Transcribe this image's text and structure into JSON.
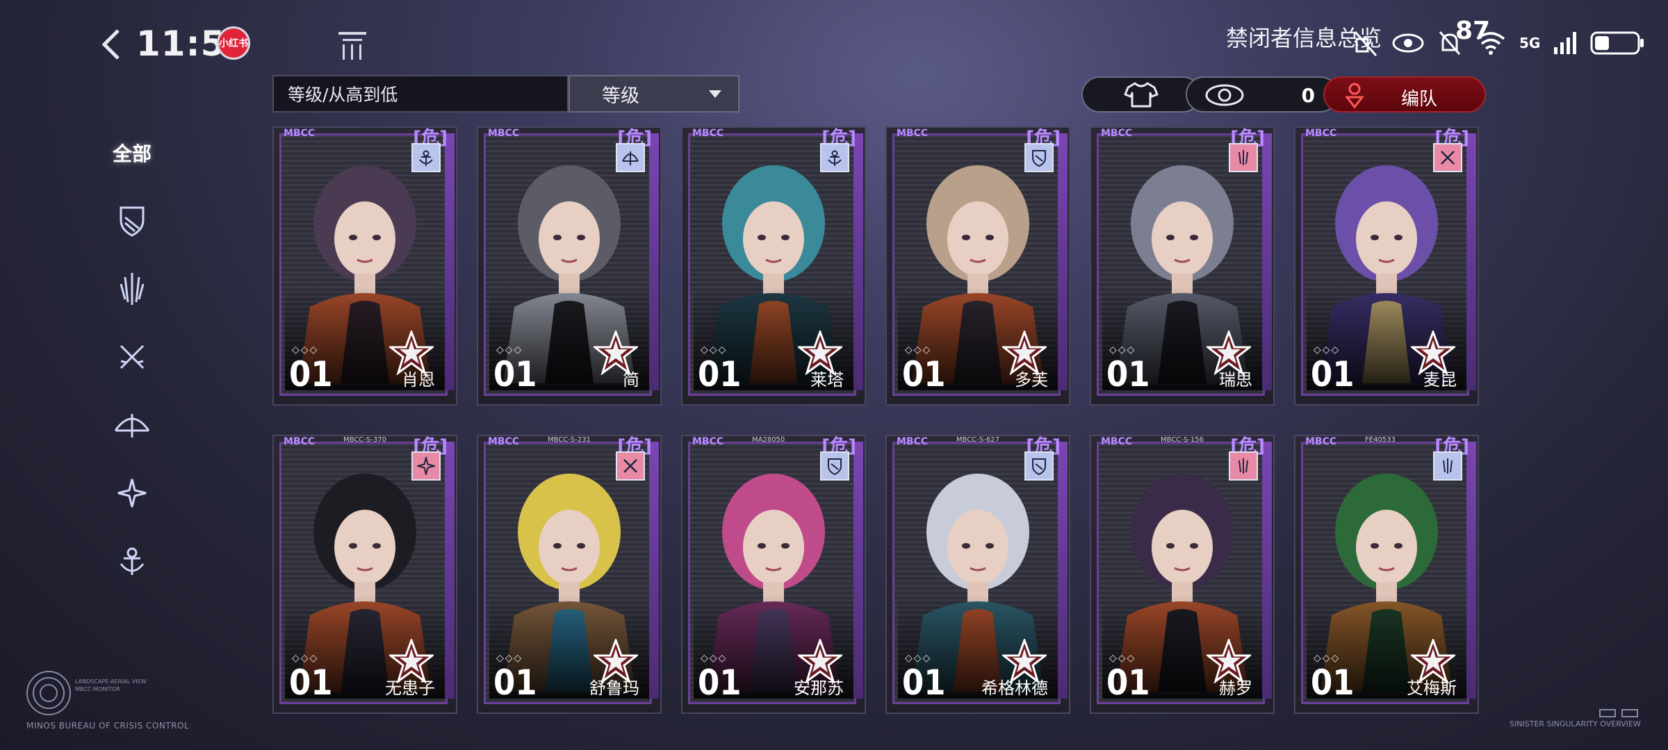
{
  "status_bar": {
    "time": "11:58",
    "notification_app": "小红书",
    "battery": "87",
    "network": "5G"
  },
  "header": {
    "title": "禁闭者信息总览",
    "watermark": "MBCC"
  },
  "toolbar": {
    "sort_label": "等级/从高到低",
    "sort_selected": "等级",
    "visibility_count": "0",
    "team_label": "编队"
  },
  "sidebar": {
    "all_label": "全部",
    "class_icons": [
      "shield-class-icon",
      "blade-class-icon",
      "crossed-swords-class-icon",
      "bow-class-icon",
      "star-class-icon",
      "support-class-icon"
    ]
  },
  "cards": [
    {
      "name": "肖恩",
      "level": "01",
      "serial": "",
      "danger": "[危]",
      "class_icon": "support-class-icon",
      "class_color": "#b9c4ec"
    },
    {
      "name": "简",
      "level": "01",
      "serial": "",
      "danger": "[危]",
      "class_icon": "bow-class-icon",
      "class_color": "#b9c4ec"
    },
    {
      "name": "莱塔",
      "level": "01",
      "serial": "",
      "danger": "[危]",
      "class_icon": "support-class-icon",
      "class_color": "#b9c4ec"
    },
    {
      "name": "多芙",
      "level": "01",
      "serial": "",
      "danger": "[危]",
      "class_icon": "shield-class-icon",
      "class_color": "#b9c4ec"
    },
    {
      "name": "瑞思",
      "level": "01",
      "serial": "",
      "danger": "[危]",
      "class_icon": "blade-class-icon",
      "class_color": "#e88aa6"
    },
    {
      "name": "麦昆",
      "level": "01",
      "serial": "",
      "danger": "[危]",
      "class_icon": "crossed-swords-class-icon",
      "class_color": "#e88aa6"
    },
    {
      "name": "无患子",
      "level": "01",
      "serial": "MBCC-S-370",
      "danger": "[危]",
      "class_icon": "star-class-icon",
      "class_color": "#e88aa6"
    },
    {
      "name": "舒鲁玛",
      "level": "01",
      "serial": "MBCC-S-231",
      "danger": "[危]",
      "class_icon": "crossed-swords-class-icon",
      "class_color": "#e88aa6"
    },
    {
      "name": "安那苏",
      "level": "01",
      "serial": "MA28050",
      "danger": "[危]",
      "class_icon": "shield-class-icon",
      "class_color": "#b9c4ec"
    },
    {
      "name": "希格林德",
      "level": "01",
      "serial": "MBCC-S-627",
      "danger": "[危]",
      "class_icon": "shield-class-icon",
      "class_color": "#b9c4ec"
    },
    {
      "name": "赫罗",
      "level": "01",
      "serial": "MBCC-S-156",
      "danger": "[危]",
      "class_icon": "blade-class-icon",
      "class_color": "#e88aa6"
    },
    {
      "name": "艾梅斯",
      "level": "01",
      "serial": "FE40533",
      "danger": "[危]",
      "class_icon": "blade-class-icon",
      "class_color": "#b9c4ec"
    }
  ],
  "footer": {
    "logo_caption": "LANDSCAPE-AERIAL VIEW MBCC-MONITOR",
    "bureau": "MINOS BUREAU OF CRISIS CONTROL",
    "overview": "SINISTER SINGULARITY OVERVIEW"
  }
}
